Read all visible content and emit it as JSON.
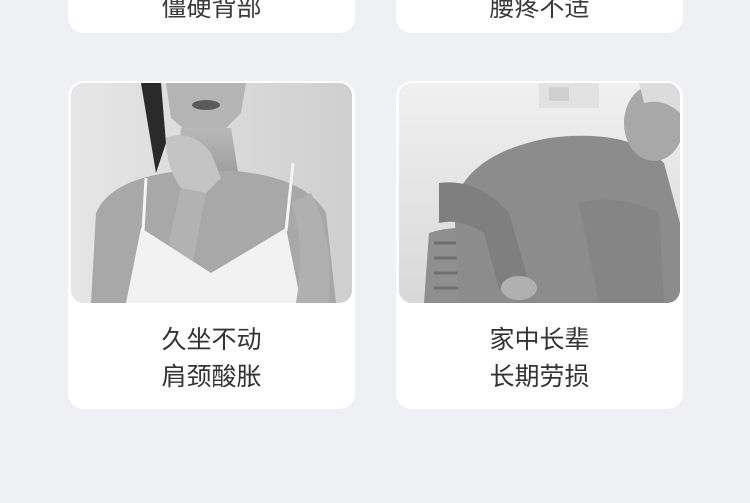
{
  "top_cards": [
    {
      "caption": "僵硬背部"
    },
    {
      "caption": "腰疼不适"
    }
  ],
  "cards": [
    {
      "image": "woman-touching-neck-photo",
      "line1": "久坐不动",
      "line2": "肩颈酸胀"
    },
    {
      "image": "elderly-man-holding-back-photo",
      "line1": "家中长辈",
      "line2": "长期劳损"
    }
  ],
  "colors": {
    "background": "#eef0f4",
    "card": "#ffffff",
    "text": "#333333"
  }
}
